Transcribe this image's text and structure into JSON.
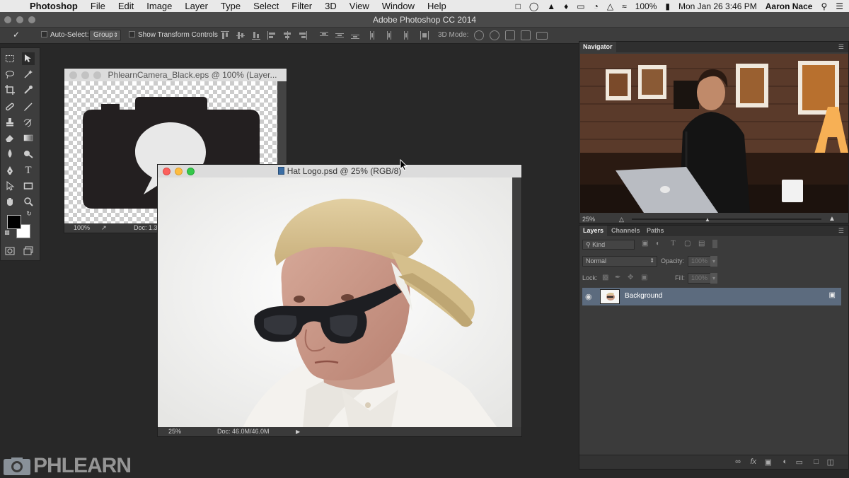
{
  "menubar": {
    "app_name": "Photoshop",
    "items": [
      "File",
      "Edit",
      "Image",
      "Layer",
      "Type",
      "Select",
      "Filter",
      "3D",
      "View",
      "Window",
      "Help"
    ],
    "battery": "100%",
    "datetime": "Mon Jan 26  3:46 PM",
    "user": "Aaron Nace"
  },
  "app": {
    "title": "Adobe Photoshop CC 2014"
  },
  "options_bar": {
    "auto_select_label": "Auto-Select:",
    "auto_select_value": "Group",
    "transform_label": "Show Transform Controls",
    "mode_3d_label": "3D Mode:"
  },
  "documents": {
    "camera": {
      "title": "PhlearnCamera_Black.eps @ 100% (Layer...",
      "zoom": "100%",
      "doc": "Doc: 1.3"
    },
    "hat": {
      "title": "Hat Logo.psd @ 25% (RGB/8)",
      "zoom": "25%",
      "doc": "Doc: 46.0M/46.0M"
    }
  },
  "navigator": {
    "tab": "Navigator",
    "zoom": "25%"
  },
  "layers_panel": {
    "tabs": [
      "Layers",
      "Channels",
      "Paths"
    ],
    "filter_kind": "Kind",
    "blend_mode": "Normal",
    "opacity_label": "Opacity:",
    "opacity_value": "100%",
    "lock_label": "Lock:",
    "fill_label": "Fill:",
    "fill_value": "100%",
    "layer_name": "Background"
  },
  "brand": {
    "text": "PHLEARN"
  },
  "colors": {
    "foreground": "#000000",
    "background": "#ffffff",
    "layer_selected": "#5c6b7e"
  }
}
